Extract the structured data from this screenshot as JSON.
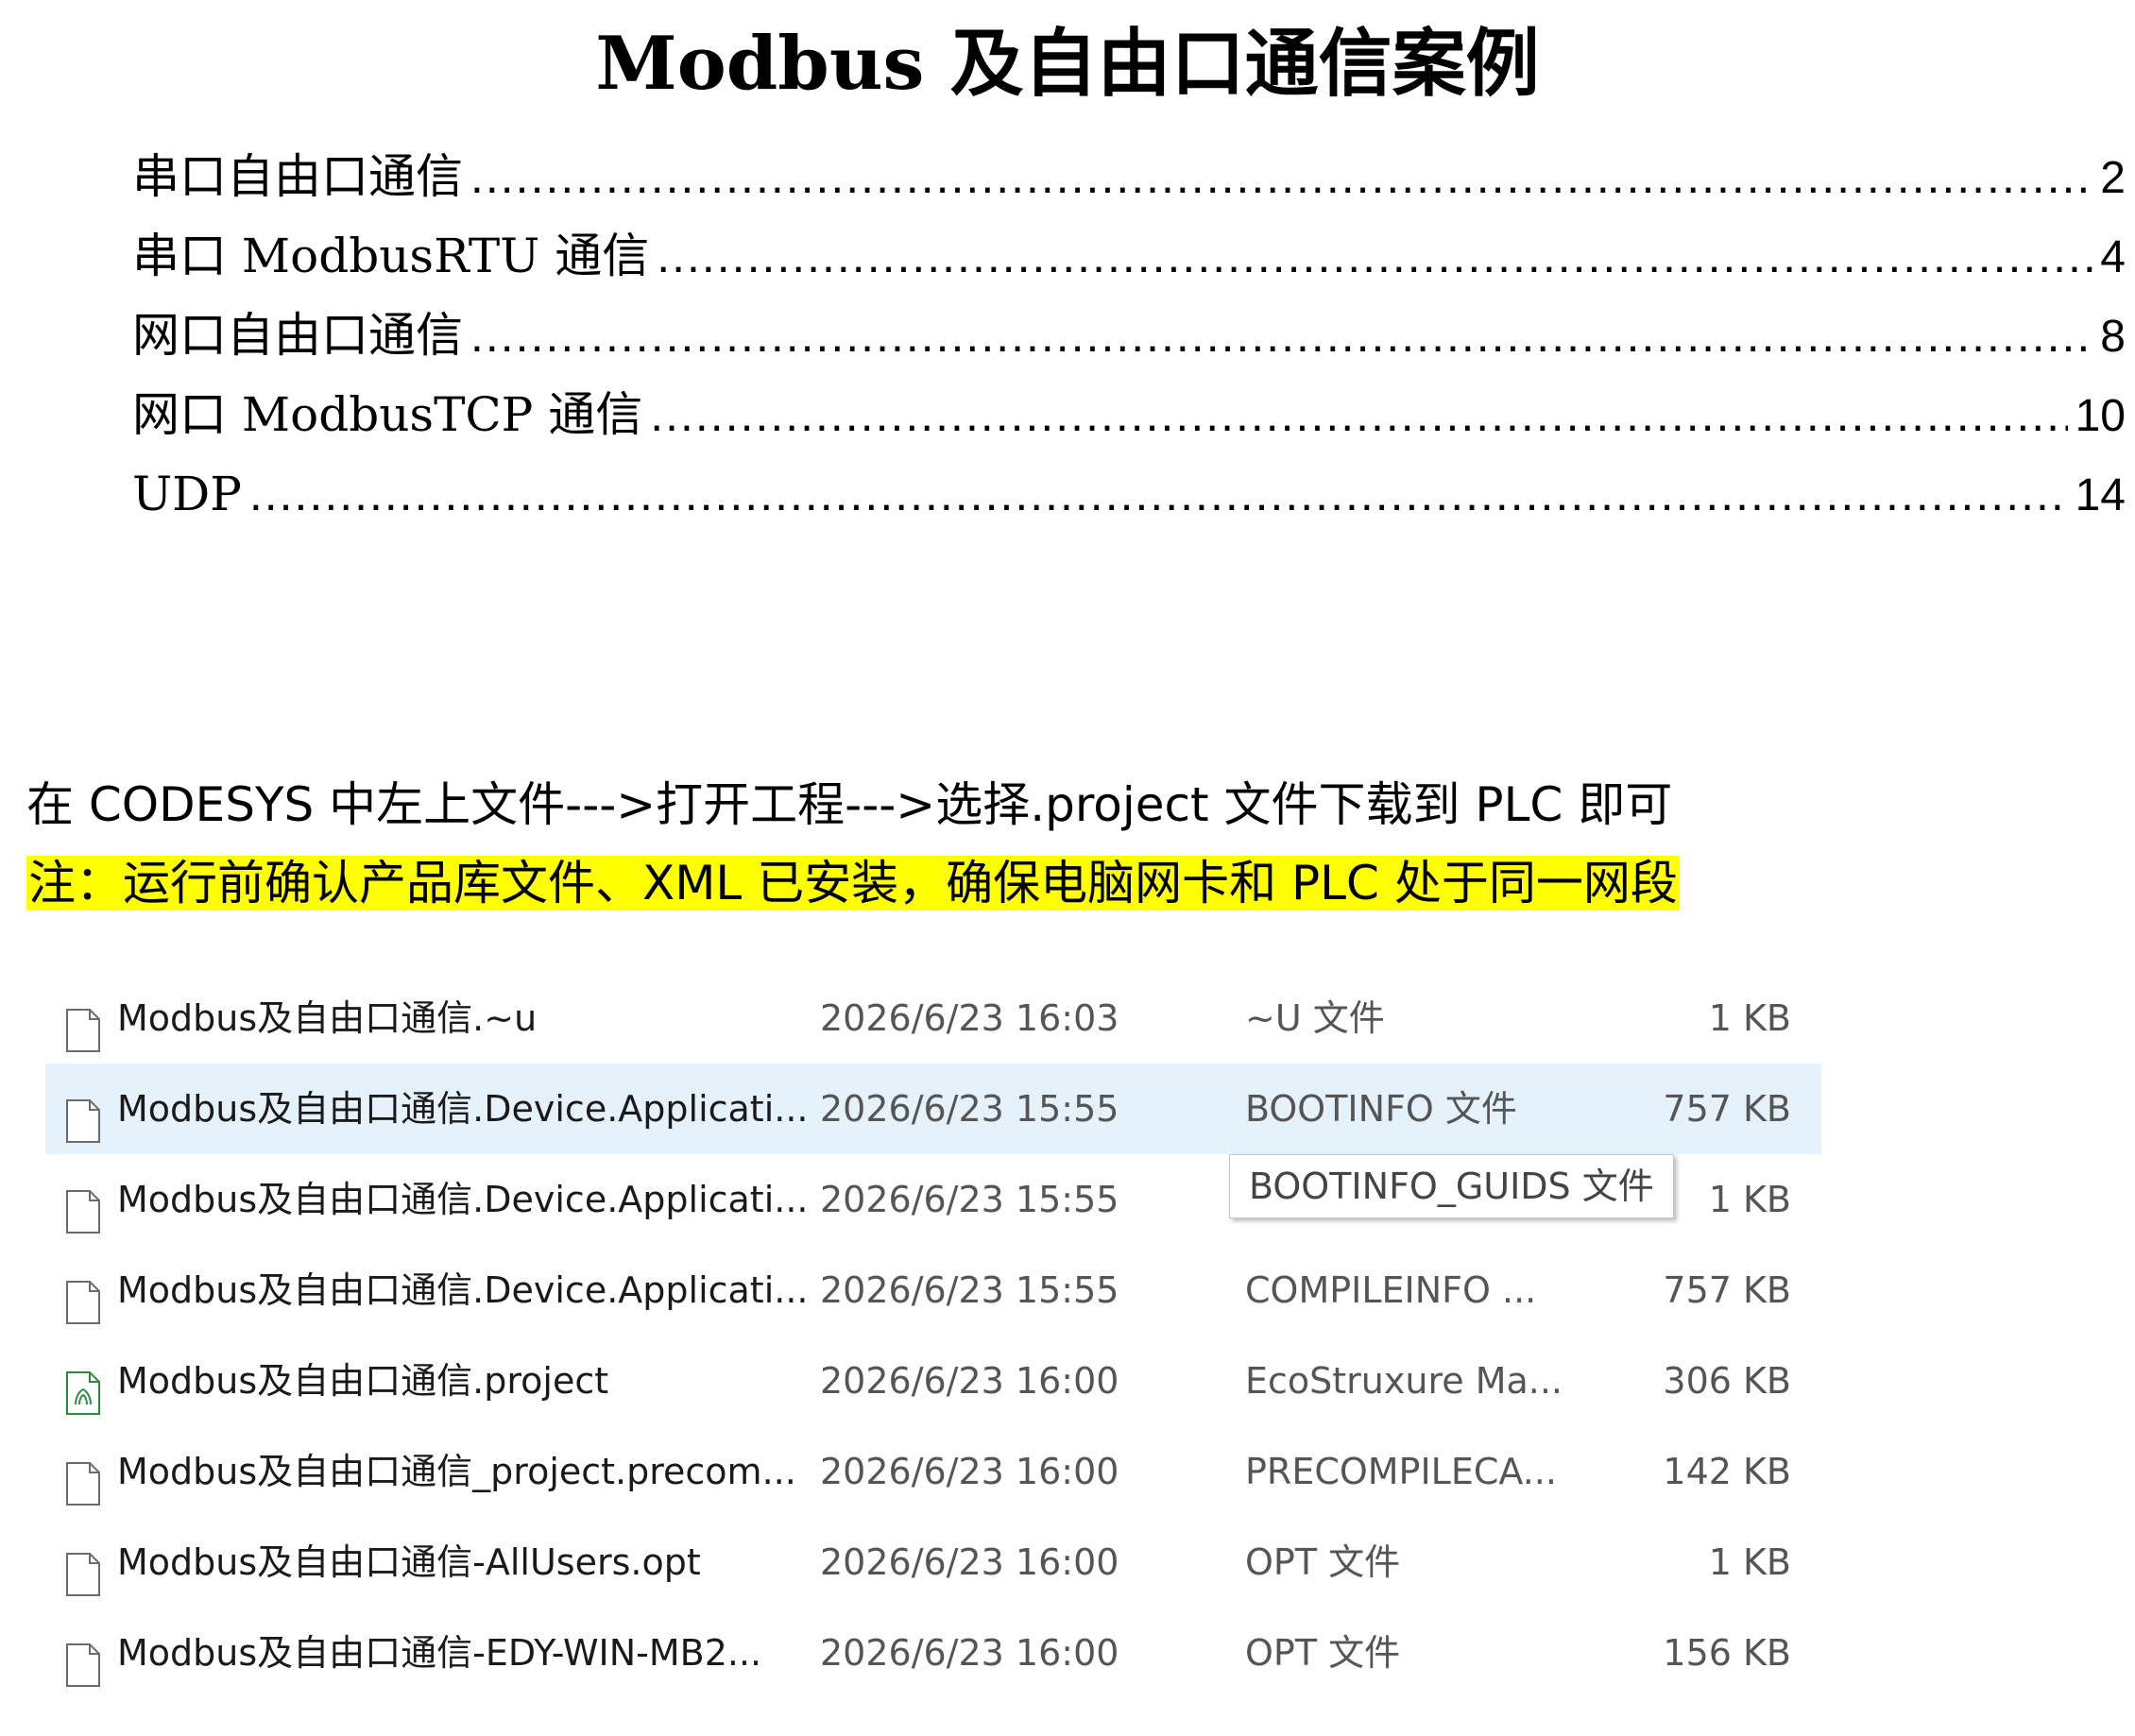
{
  "title": "Modbus 及自由口通信案例",
  "toc": [
    {
      "label": "串口自由口通信",
      "page": "2"
    },
    {
      "label": "串口 ModbusRTU 通信",
      "page": "4"
    },
    {
      "label": "网口自由口通信",
      "page": "8"
    },
    {
      "label": "网口 ModbusTCP 通信",
      "page": "10"
    },
    {
      "label": "UDP",
      "page": "14"
    }
  ],
  "instruction": "在 CODESYS 中左上文件--->打开工程--->选择.project 文件下载到 PLC 即可",
  "note": "注：运行前确认产品库文件、XML 已安装，确保电脑网卡和 PLC 处于同一网段",
  "highlight_color": "#ffff00",
  "files": [
    {
      "name": "Modbus及自由口通信.~u",
      "date": "2026/6/23 16:03",
      "type": "~U 文件",
      "size": "1 KB",
      "icon": "file-icon"
    },
    {
      "name": "Modbus及自由口通信.Device.Applicati...",
      "date": "2026/6/23 15:55",
      "type": "BOOTINFO 文件",
      "size": "757 KB",
      "icon": "file-icon"
    },
    {
      "name": "Modbus及自由口通信.Device.Applicati...",
      "date": "2026/6/23 15:55",
      "type": "",
      "size": "1 KB",
      "icon": "file-icon"
    },
    {
      "name": "Modbus及自由口通信.Device.Applicati...",
      "date": "2026/6/23 15:55",
      "type": "COMPILEINFO ...",
      "size": "757 KB",
      "icon": "file-icon"
    },
    {
      "name": "Modbus及自由口通信.project",
      "date": "2026/6/23 16:00",
      "type": "EcoStruxure Ma...",
      "size": "306 KB",
      "icon": "project-file-icon"
    },
    {
      "name": "Modbus及自由口通信_project.precom...",
      "date": "2026/6/23 16:00",
      "type": "PRECOMPILECA...",
      "size": "142 KB",
      "icon": "file-icon"
    },
    {
      "name": "Modbus及自由口通信-AllUsers.opt",
      "date": "2026/6/23 16:00",
      "type": "OPT 文件",
      "size": "1 KB",
      "icon": "file-icon"
    },
    {
      "name": "Modbus及自由口通信-EDY-WIN-MB2...",
      "date": "2026/6/23 16:00",
      "type": "OPT 文件",
      "size": "156 KB",
      "icon": "file-icon"
    }
  ],
  "tooltip": "BOOTINFO_GUIDS 文件",
  "selected_row_color": "#e5f1fb"
}
